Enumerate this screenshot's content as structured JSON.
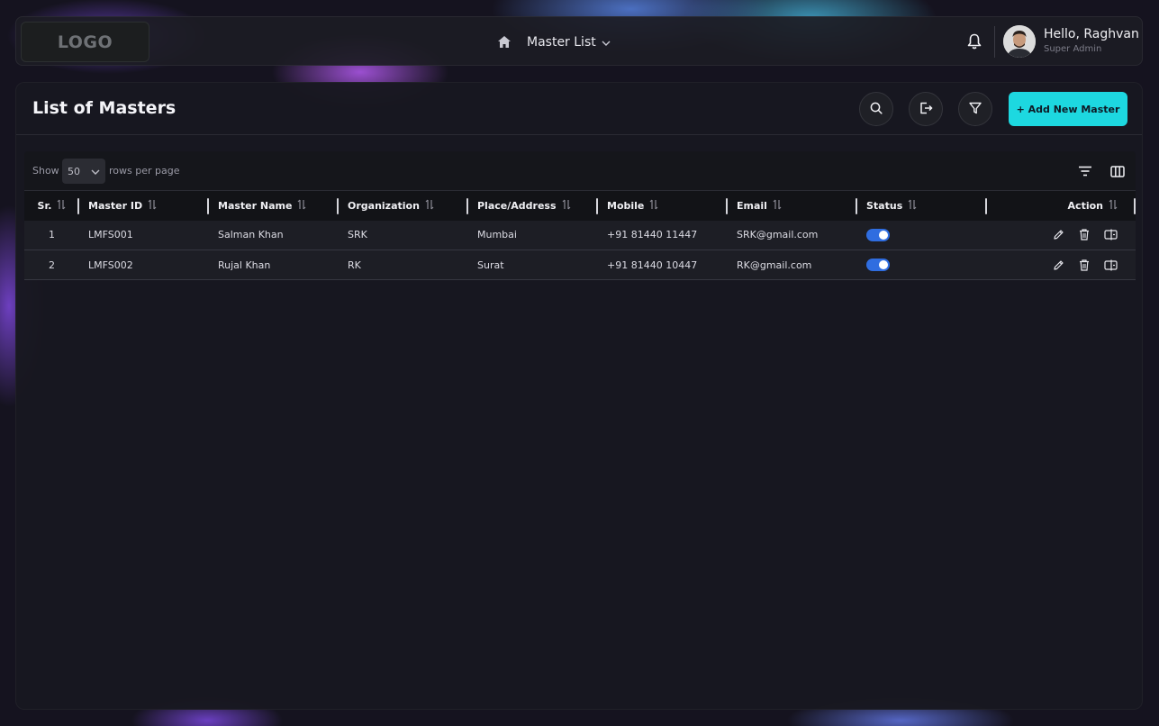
{
  "header": {
    "logo": "LOGO",
    "nav_title": "Master List",
    "user_name": "Hello, Raghvan",
    "user_role": "Super Admin"
  },
  "page": {
    "title": "List of Masters",
    "add_button": "+ Add New Master"
  },
  "toolbar": {
    "show_label": "Show",
    "rows_value": "50",
    "rows_label": "rows per page"
  },
  "table": {
    "columns": [
      "Sr.",
      "Master ID",
      "Master Name",
      "Organization",
      "Place/Address",
      "Mobile",
      "Email",
      "Status",
      "",
      "Action"
    ],
    "rows": [
      {
        "sr": "1",
        "id": "LMFS001",
        "name": "Salman Khan",
        "org": "SRK",
        "place": "Mumbai",
        "mobile": "+91 81440 11447",
        "email": "SRK@gmail.com",
        "status_on": true
      },
      {
        "sr": "2",
        "id": "LMFS002",
        "name": "Rujal Khan",
        "org": "RK",
        "place": "Surat",
        "mobile": "+91 81440 10447",
        "email": "RK@gmail.com",
        "status_on": true
      }
    ]
  },
  "colors": {
    "accent": "#1dd8e0",
    "toggle": "#2f6de0",
    "panel": "#18181f"
  },
  "icons": [
    "home-icon",
    "chevron-down-icon",
    "bell-icon",
    "search-icon",
    "export-icon",
    "filter-icon",
    "sort-icon",
    "columns-icon",
    "edit-icon",
    "delete-icon",
    "view-icon"
  ]
}
